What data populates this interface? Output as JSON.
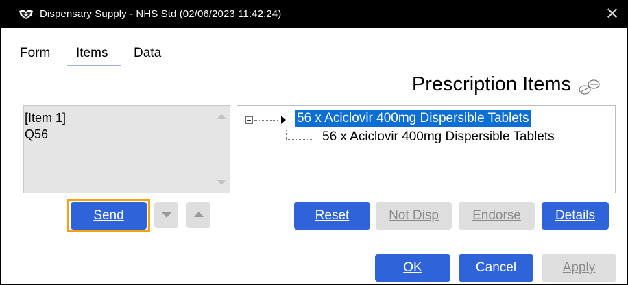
{
  "window": {
    "title": "Dispensary Supply - NHS Std (02/06/2023 11:42:24)",
    "close_glyph": "✕"
  },
  "menu": {
    "form": "Form",
    "items": "Items",
    "data": "Data",
    "active": "Items"
  },
  "heading": "Prescription Items",
  "left_panel": {
    "line1": "[Item 1]",
    "line2": "Q56"
  },
  "tree": {
    "parent": "56 x Aciclovir 400mg Dispersible Tablets",
    "child": "56 x Aciclovir 400mg Dispersible Tablets",
    "expander_state": "expanded"
  },
  "buttons": {
    "send": "Send",
    "reset": "Reset",
    "not_disp": "Not Disp",
    "endorse": "Endorse",
    "details": "Details",
    "ok": "OK",
    "cancel": "Cancel",
    "apply": "Apply",
    "move_down": "move-down",
    "move_up": "move-up"
  },
  "states": {
    "send": "focused",
    "not_disp": "disabled",
    "endorse": "disabled",
    "apply": "disabled",
    "move_down": "disabled",
    "move_up": "disabled"
  },
  "colors": {
    "titlebar": "#000000",
    "primary_button": "#2f63d8",
    "disabled_button": "#dedede",
    "selection": "#0a6ed4",
    "focus_ring": "#f7a20c",
    "list_background": "#e5e5e5"
  },
  "icons": {
    "app": "shield-crest-icon",
    "close": "close-icon",
    "pills": "pills-icon",
    "expander": "tree-collapse-icon",
    "pointer": "current-item-pointer-icon"
  }
}
